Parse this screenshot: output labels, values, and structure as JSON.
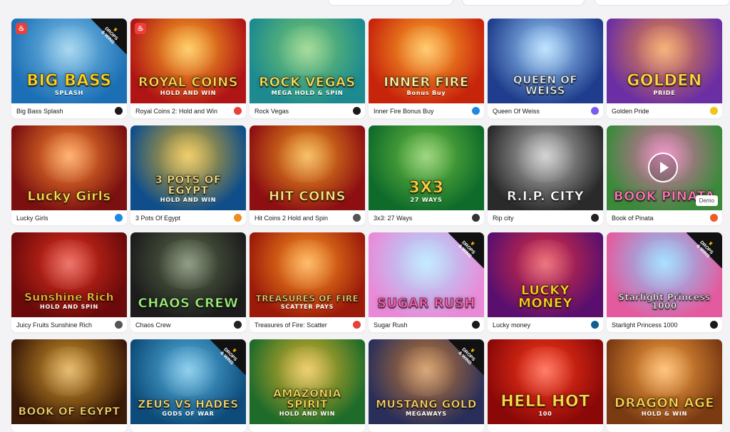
{
  "topbar": {
    "filters": [
      "",
      "",
      ""
    ]
  },
  "badges": {
    "drops_line1": "DROPS",
    "drops_line2": "& WINS",
    "demo": "Demo"
  },
  "games": [
    {
      "name": "Big Bass Splash",
      "art_title": "BIG BASS",
      "art_sub": "SPLASH",
      "bg1": "#1c6fb5",
      "bg2": "#7fc3e8",
      "text": "#ffd21f",
      "hot": true,
      "drops": true,
      "provider": "pragmatic",
      "prov_color": "#1a1a1a"
    },
    {
      "name": "Royal Coins 2: Hold and Win",
      "art_title": "ROYAL COINS",
      "art_sub": "HOLD AND WIN",
      "bg1": "#b01515",
      "bg2": "#ffb623",
      "text": "#ffd54a",
      "hot": true,
      "drops": false,
      "provider": "playson",
      "prov_color": "#e8403b"
    },
    {
      "name": "Rock Vegas",
      "art_title": "ROCK VEGAS",
      "art_sub": "MEGA HOLD & SPIN",
      "bg1": "#1c8a8f",
      "bg2": "#79c96b",
      "text": "#f4e15a",
      "hot": false,
      "drops": false,
      "provider": "pragmatic",
      "prov_color": "#1a1a1a"
    },
    {
      "name": "Inner Fire Bonus Buy",
      "art_title": "INNER FIRE",
      "art_sub": "Bonus Buy",
      "bg1": "#c7240c",
      "bg2": "#ffb12a",
      "text": "#fff2a0",
      "hot": false,
      "drops": false,
      "provider": "eg",
      "prov_color": "#1e88e5"
    },
    {
      "name": "Queen Of Weiss",
      "art_title": "QUEEN OF WEISS",
      "art_sub": "",
      "bg1": "#1f3d8c",
      "bg2": "#9fd4ff",
      "text": "#e9f4ff",
      "hot": false,
      "drops": false,
      "provider": "bgaming",
      "prov_color": "#7b5cf0"
    },
    {
      "name": "Golden Pride",
      "art_title": "GOLDEN",
      "art_sub": "PRIDE",
      "bg1": "#6b2fa3",
      "bg2": "#f08b3a",
      "text": "#ffd548",
      "hot": false,
      "drops": false,
      "provider": "bsg",
      "prov_color": "#f2c21d"
    },
    {
      "name": "Lucky Girls",
      "art_title": "Lucky Girls",
      "art_sub": "",
      "bg1": "#7a1010",
      "bg2": "#ff8b2e",
      "text": "#ffe14d",
      "hot": false,
      "drops": false,
      "provider": "eg",
      "prov_color": "#1e88e5"
    },
    {
      "name": "3 Pots Of Egypt",
      "art_title": "3 POTS OF EGYPT",
      "art_sub": "HOLD AND WIN",
      "bg1": "#0f4e8a",
      "bg2": "#e8b423",
      "text": "#ffe38a",
      "hot": false,
      "drops": false,
      "provider": "booongo",
      "prov_color": "#f08b1d"
    },
    {
      "name": "Hit Coins 2 Hold and Spin",
      "art_title": "HIT COINS",
      "art_sub": "",
      "bg1": "#8e0f12",
      "bg2": "#f3a01d",
      "text": "#ffe57a",
      "hot": false,
      "drops": false,
      "provider": "grid",
      "prov_color": "#555555"
    },
    {
      "name": "3x3: 27 Ways",
      "art_title": "3X3",
      "art_sub": "27 WAYS",
      "bg1": "#0e6b2a",
      "bg2": "#6fc141",
      "text": "#ffd040",
      "hot": false,
      "drops": false,
      "provider": "gamzix",
      "prov_color": "#333333"
    },
    {
      "name": "Rip city",
      "art_title": "R.I.P. CITY",
      "art_sub": "",
      "bg1": "#2a2a2a",
      "bg2": "#bdbdbd",
      "text": "#ffffff",
      "hot": false,
      "drops": false,
      "provider": "hacksaw",
      "prov_color": "#222222"
    },
    {
      "name": "Book of Pinata",
      "art_title": "BOOK PINATA",
      "art_sub": "",
      "bg1": "#3a8a3a",
      "bg2": "#e56bb0",
      "text": "#ff77b5",
      "hot": false,
      "drops": false,
      "provider": "spinomenal",
      "prov_color": "#f05a28",
      "demo": true
    },
    {
      "name": "Juicy Fruits Sunshine Rich",
      "art_title": "Sunshine Rich",
      "art_sub": "HOLD AND SPIN",
      "bg1": "#6a0a0a",
      "bg2": "#e5301f",
      "text": "#ffc83a",
      "hot": false,
      "drops": false,
      "provider": "grid",
      "prov_color": "#555555"
    },
    {
      "name": "Chaos Crew",
      "art_title": "CHAOS CREW",
      "art_sub": "",
      "bg1": "#1c1c1c",
      "bg2": "#5a6b4a",
      "text": "#9df07a",
      "hot": false,
      "drops": false,
      "provider": "hacksaw",
      "prov_color": "#222222"
    },
    {
      "name": "Treasures of Fire: Scatter",
      "art_title": "TREASURES OF FIRE",
      "art_sub": "SCATTER PAYS",
      "bg1": "#9c1a0a",
      "bg2": "#ff9a1f",
      "text": "#ffe077",
      "hot": false,
      "drops": false,
      "provider": "playson",
      "prov_color": "#e8403b"
    },
    {
      "name": "Sugar Rush",
      "art_title": "SUGAR RUSH",
      "art_sub": "",
      "bg1": "#e98ad8",
      "bg2": "#a7e1ff",
      "text": "#ff5db2",
      "hot": false,
      "drops": true,
      "provider": "pragmatic",
      "prov_color": "#1a1a1a"
    },
    {
      "name": "Lucky money",
      "art_title": "LUCKY MONEY",
      "art_sub": "",
      "bg1": "#5a0f6e",
      "bg2": "#e3303e",
      "text": "#ffd21f",
      "hot": false,
      "drops": false,
      "provider": "pgsoft",
      "prov_color": "#0f5e8c"
    },
    {
      "name": "Starlight Princess 1000",
      "art_title": "Starlight Princess 1000",
      "art_sub": "",
      "bg1": "#e35b9e",
      "bg2": "#7fd0ff",
      "text": "#ffffff",
      "hot": false,
      "drops": true,
      "provider": "pragmatic",
      "prov_color": "#1a1a1a"
    },
    {
      "name": "Book of Egypt",
      "art_title": "BOOK OF EGYPT",
      "art_sub": "",
      "bg1": "#3a1a08",
      "bg2": "#d89a2a",
      "text": "#ffd56a",
      "hot": false,
      "drops": false,
      "provider": "",
      "prov_color": "#ffffff"
    },
    {
      "name": "Zeus vs Hades",
      "art_title": "ZEUS VS HADES",
      "art_sub": "GODS OF WAR",
      "bg1": "#0d4c7a",
      "bg2": "#58b6e3",
      "text": "#ffe27a",
      "hot": false,
      "drops": true,
      "provider": "",
      "prov_color": "#ffffff"
    },
    {
      "name": "Amazonia Spirit",
      "art_title": "AMAZONIA SPIRIT",
      "art_sub": "HOLD AND WIN",
      "bg1": "#1e6b2a",
      "bg2": "#e6b52b",
      "text": "#ffe35a",
      "hot": false,
      "drops": false,
      "provider": "",
      "prov_color": "#ffffff"
    },
    {
      "name": "Mustang Gold Megaways",
      "art_title": "MUSTANG GOLD",
      "art_sub": "MEGAWAYS",
      "bg1": "#2a2f5a",
      "bg2": "#c57a33",
      "text": "#ffd56a",
      "hot": false,
      "drops": true,
      "provider": "",
      "prov_color": "#ffffff"
    },
    {
      "name": "Hell Hot 100",
      "art_title": "HELL HOT",
      "art_sub": "100",
      "bg1": "#8a0808",
      "bg2": "#ff3a1a",
      "text": "#ffd84a",
      "hot": false,
      "drops": false,
      "provider": "",
      "prov_color": "#ffffff"
    },
    {
      "name": "Dragon Age",
      "art_title": "DRAGON AGE",
      "art_sub": "HOLD & WIN",
      "bg1": "#7a3a12",
      "bg2": "#ffa640",
      "text": "#ffd24a",
      "hot": false,
      "drops": false,
      "provider": "",
      "prov_color": "#ffffff"
    }
  ]
}
